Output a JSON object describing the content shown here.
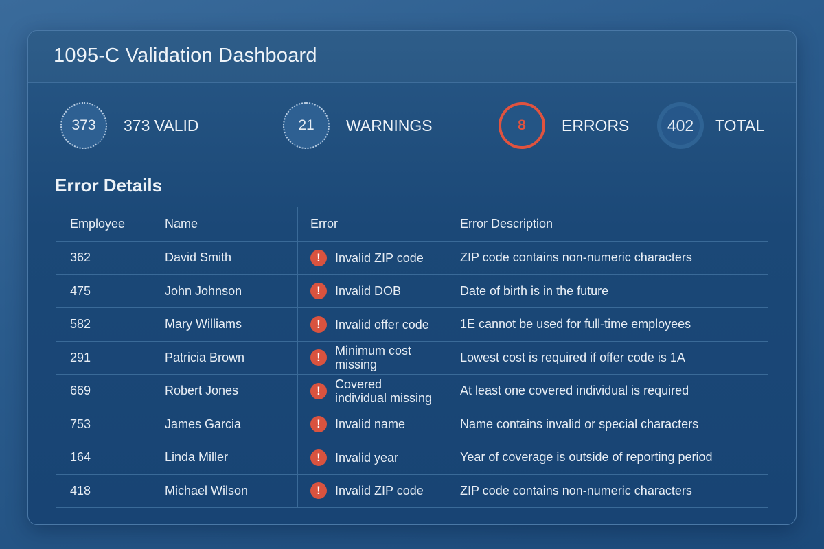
{
  "header": {
    "title": "1095-C Validation Dashboard"
  },
  "stats": [
    {
      "value": "373",
      "label": "373 VALID"
    },
    {
      "value": "21",
      "label": "WARNINGS"
    },
    {
      "value": "8",
      "label": "ERRORS"
    },
    {
      "value": "402",
      "label": "TOTAL"
    }
  ],
  "colors": {
    "error": "#e0533f",
    "background": "#1c4a7a"
  },
  "section_title": "Error Details",
  "table": {
    "columns": [
      "Employee",
      "Name",
      "Error",
      "Error Description"
    ],
    "rows": [
      {
        "id": "362",
        "name": "David Smith",
        "error": "Invalid ZIP code",
        "desc": "ZIP code contains non-numeric characters"
      },
      {
        "id": "475",
        "name": "John Johnson",
        "error": "Invalid DOB",
        "desc": "Date of birth is in the future"
      },
      {
        "id": "582",
        "name": "Mary Williams",
        "error": "Invalid offer code",
        "desc": "1E cannot be used for full-time employees"
      },
      {
        "id": "291",
        "name": "Patricia Brown",
        "error": "Minimum cost missing",
        "desc": "Lowest cost is required if offer code is 1A"
      },
      {
        "id": "669",
        "name": "Robert Jones",
        "error": "Covered individual missing",
        "desc": "At least one covered individual is required"
      },
      {
        "id": "753",
        "name": "James Garcia",
        "error": "Invalid name",
        "desc": "Name contains invalid or special characters"
      },
      {
        "id": "164",
        "name": "Linda Miller",
        "error": "Invalid year",
        "desc": "Year of coverage is outside of reporting period"
      },
      {
        "id": "418",
        "name": "Michael Wilson",
        "error": "Invalid ZIP code",
        "desc": "ZIP code contains non-numeric characters"
      }
    ]
  }
}
